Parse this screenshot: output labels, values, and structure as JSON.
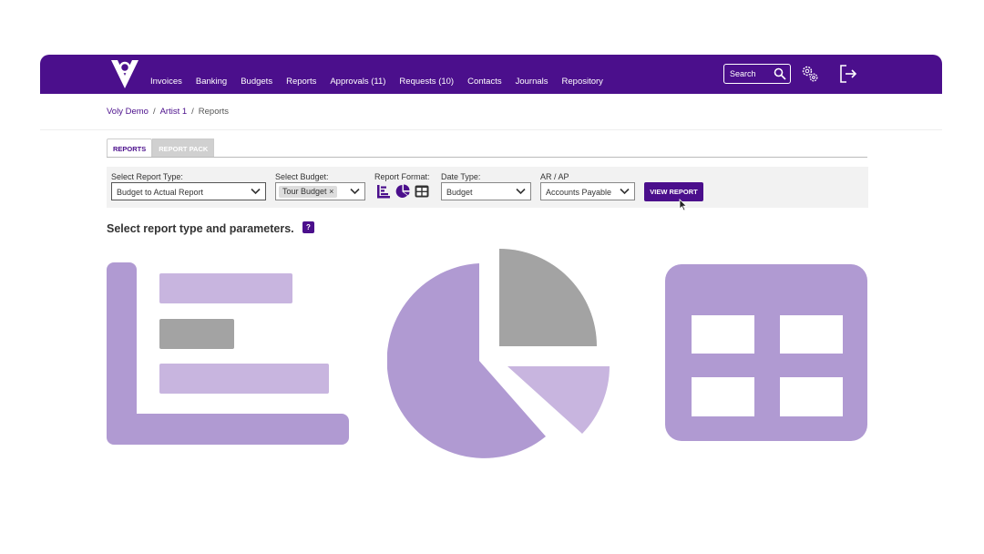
{
  "nav": {
    "items": [
      {
        "label": "Invoices"
      },
      {
        "label": "Banking"
      },
      {
        "label": "Budgets"
      },
      {
        "label": "Reports"
      },
      {
        "label": "Approvals (11)"
      },
      {
        "label": "Requests (10)"
      },
      {
        "label": "Contacts"
      },
      {
        "label": "Journals"
      },
      {
        "label": "Repository"
      }
    ],
    "search_placeholder": "Search",
    "icons": [
      "logo-icon",
      "search-icon",
      "gear-icon",
      "logout-icon"
    ]
  },
  "breadcrumb": {
    "items": [
      {
        "label": "Voly Demo",
        "link": true
      },
      {
        "label": "/",
        "link": false
      },
      {
        "label": "Artist 1",
        "link": true
      },
      {
        "label": "/",
        "link": false
      },
      {
        "label": "Reports",
        "link": false
      }
    ]
  },
  "tabs": [
    {
      "label": "REPORTS",
      "active": true
    },
    {
      "label": "REPORT PACK",
      "active": false
    }
  ],
  "params": {
    "report_type": {
      "label": "Select Report Type:",
      "value": "Budget to Actual Report"
    },
    "budget": {
      "label": "Select Budget:",
      "tag": "Tour Budget",
      "tag_remove": "×"
    },
    "format": {
      "label": "Report Format:",
      "icons": [
        "bar-chart-icon",
        "pie-chart-icon",
        "table-icon"
      ]
    },
    "date_type": {
      "label": "Date Type:",
      "value": "Budget"
    },
    "ar_ap": {
      "label": "AR / AP",
      "value": "Accounts Payable"
    },
    "view_button": "VIEW REPORT"
  },
  "main": {
    "heading": "Select report type and parameters.",
    "help": "?"
  },
  "colors": {
    "brand": "#4b0f8c",
    "illus_purple": "#b09ad2",
    "illus_light": "#c8b5df",
    "illus_gray": "#a3a3a3"
  }
}
